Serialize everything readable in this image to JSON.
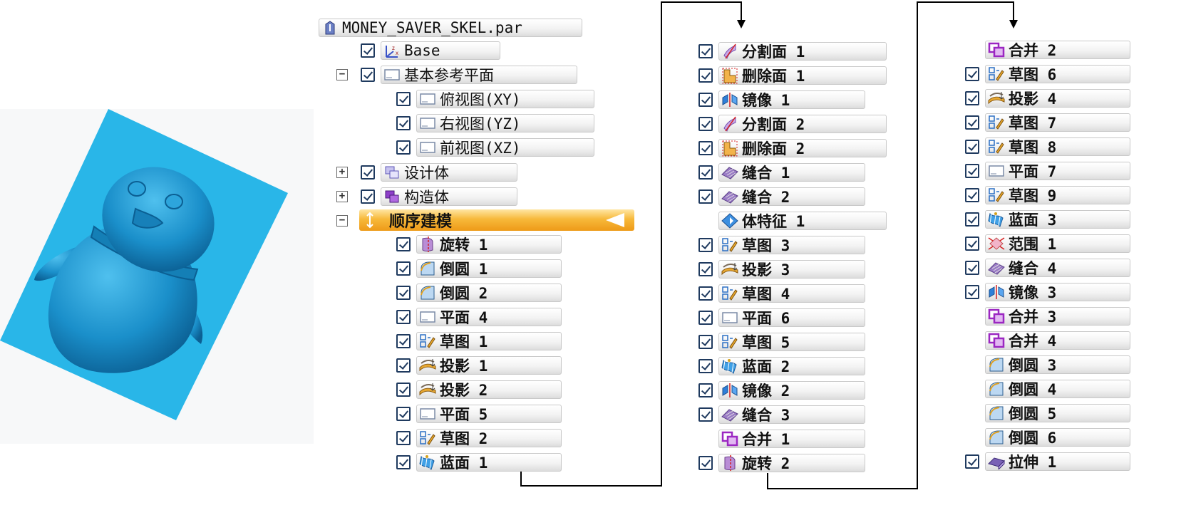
{
  "colors": {
    "model_blue": "#1a91c9",
    "bg_cyan": "#29b6e8",
    "highlight": "#f2a524"
  },
  "root": {
    "label": "MONEY_SAVER_SKEL.par",
    "icon": "part-icon"
  },
  "top_items": [
    {
      "label": "Base",
      "checked": true,
      "icon": "coordinate-system-icon",
      "bold": false
    },
    {
      "label": "基本参考平面",
      "checked": true,
      "icon": "plane-icon",
      "bold": false,
      "expander": "−"
    },
    {
      "label": "俯视图(XY)",
      "checked": true,
      "icon": "plane-icon",
      "bold": false
    },
    {
      "label": "右视图(YZ)",
      "checked": true,
      "icon": "plane-icon",
      "bold": false
    },
    {
      "label": "前视图(XZ)",
      "checked": true,
      "icon": "plane-icon",
      "bold": false
    },
    {
      "label": "设计体",
      "checked": true,
      "icon": "design-body-icon",
      "bold": false,
      "expander": "+"
    },
    {
      "label": "构造体",
      "checked": true,
      "icon": "construction-body-icon",
      "bold": false,
      "expander": "+"
    }
  ],
  "sequence": {
    "label": "顺序建模",
    "expander": "−"
  },
  "column1": [
    {
      "label": "旋转 1",
      "checked": true,
      "icon": "revolve-icon"
    },
    {
      "label": "倒圆 1",
      "checked": true,
      "icon": "round-icon"
    },
    {
      "label": "倒圆 2",
      "checked": true,
      "icon": "round-icon"
    },
    {
      "label": "平面 4",
      "checked": true,
      "icon": "plane-icon"
    },
    {
      "label": "草图 1",
      "checked": true,
      "icon": "sketch-icon"
    },
    {
      "label": "投影 1",
      "checked": true,
      "icon": "projection-icon"
    },
    {
      "label": "投影 2",
      "checked": true,
      "icon": "projection-icon"
    },
    {
      "label": "平面 5",
      "checked": true,
      "icon": "plane-icon"
    },
    {
      "label": "草图 2",
      "checked": true,
      "icon": "sketch-icon"
    },
    {
      "label": "蓝面 1",
      "checked": true,
      "icon": "bluesurf-icon"
    }
  ],
  "column2": [
    {
      "label": "分割面 1",
      "checked": true,
      "icon": "split-face-icon"
    },
    {
      "label": "删除面 1",
      "checked": true,
      "icon": "delete-face-icon"
    },
    {
      "label": "镜像 1",
      "checked": true,
      "icon": "mirror-icon"
    },
    {
      "label": "分割面 2",
      "checked": true,
      "icon": "split-face-icon"
    },
    {
      "label": "删除面 2",
      "checked": true,
      "icon": "delete-face-icon"
    },
    {
      "label": "缝合 1",
      "checked": true,
      "icon": "stitch-icon"
    },
    {
      "label": "缝合 2",
      "checked": true,
      "icon": "stitch-icon"
    },
    {
      "label": "体特征 1",
      "checked": false,
      "icon": "body-feature-icon"
    },
    {
      "label": "草图 3",
      "checked": true,
      "icon": "sketch-icon"
    },
    {
      "label": "投影 3",
      "checked": true,
      "icon": "projection-icon"
    },
    {
      "label": "草图 4",
      "checked": true,
      "icon": "sketch-icon"
    },
    {
      "label": "平面 6",
      "checked": true,
      "icon": "plane-icon"
    },
    {
      "label": "草图 5",
      "checked": true,
      "icon": "sketch-icon"
    },
    {
      "label": "蓝面 2",
      "checked": true,
      "icon": "bluesurf-icon"
    },
    {
      "label": "镜像 2",
      "checked": true,
      "icon": "mirror-icon"
    },
    {
      "label": "缝合 3",
      "checked": true,
      "icon": "stitch-icon"
    },
    {
      "label": "合并 1",
      "checked": false,
      "icon": "union-icon"
    },
    {
      "label": "旋转 2",
      "checked": true,
      "icon": "revolve-icon"
    }
  ],
  "column3": [
    {
      "label": "合并 2",
      "checked": false,
      "icon": "union-icon"
    },
    {
      "label": "草图 6",
      "checked": true,
      "icon": "sketch-icon"
    },
    {
      "label": "投影 4",
      "checked": true,
      "icon": "projection-icon"
    },
    {
      "label": "草图 7",
      "checked": true,
      "icon": "sketch-icon"
    },
    {
      "label": "草图 8",
      "checked": true,
      "icon": "sketch-icon"
    },
    {
      "label": "平面 7",
      "checked": true,
      "icon": "plane-icon"
    },
    {
      "label": "草图 9",
      "checked": true,
      "icon": "sketch-icon"
    },
    {
      "label": "蓝面 3",
      "checked": true,
      "icon": "bluesurf-icon"
    },
    {
      "label": "范围 1",
      "checked": true,
      "icon": "bounded-icon"
    },
    {
      "label": "缝合 4",
      "checked": true,
      "icon": "stitch-icon"
    },
    {
      "label": "镜像 3",
      "checked": true,
      "icon": "mirror-icon"
    },
    {
      "label": "合并 3",
      "checked": false,
      "icon": "union-icon"
    },
    {
      "label": "合并 4",
      "checked": false,
      "icon": "union-icon"
    },
    {
      "label": "倒圆 3",
      "checked": false,
      "icon": "round-icon"
    },
    {
      "label": "倒圆 4",
      "checked": false,
      "icon": "round-icon"
    },
    {
      "label": "倒圆 5",
      "checked": false,
      "icon": "round-icon"
    },
    {
      "label": "倒圆 6",
      "checked": false,
      "icon": "round-icon"
    },
    {
      "label": "拉伸 1",
      "checked": true,
      "icon": "extrude-icon"
    }
  ]
}
